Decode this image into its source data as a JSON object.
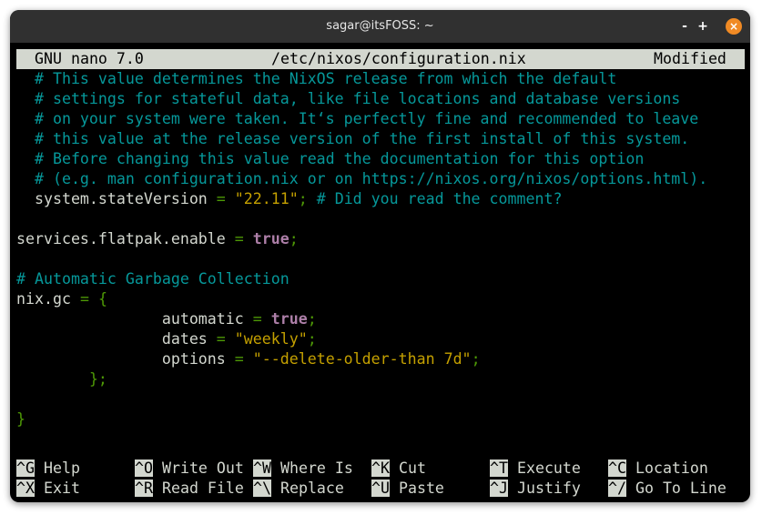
{
  "window": {
    "title": "sagar@itsFOSS: ~",
    "controls": {
      "minimize": "-",
      "maximize": "+",
      "close": "×"
    }
  },
  "nano": {
    "version": "GNU nano 7.0",
    "filename": "/etc/nixos/configuration.nix",
    "state": "Modified"
  },
  "lines": [
    [
      {
        "t": "  ",
        "c": "def"
      },
      {
        "t": "# This value determines the NixOS release from which the default",
        "c": "comment"
      }
    ],
    [
      {
        "t": "  ",
        "c": "def"
      },
      {
        "t": "# settings for stateful data, like file locations and database versions",
        "c": "comment"
      }
    ],
    [
      {
        "t": "  ",
        "c": "def"
      },
      {
        "t": "# on your system were taken. It‘s perfectly fine and recommended to leave",
        "c": "comment"
      }
    ],
    [
      {
        "t": "  ",
        "c": "def"
      },
      {
        "t": "# this value at the release version of the first install of this system.",
        "c": "comment"
      }
    ],
    [
      {
        "t": "  ",
        "c": "def"
      },
      {
        "t": "# Before changing this value read the documentation for this option",
        "c": "comment"
      }
    ],
    [
      {
        "t": "  ",
        "c": "def"
      },
      {
        "t": "# (e.g. man configuration.nix or on https://nixos.org/nixos/options.html).",
        "c": "comment"
      }
    ],
    [
      {
        "t": "  system.stateVersion ",
        "c": "def"
      },
      {
        "t": "=",
        "c": "op"
      },
      {
        "t": " ",
        "c": "def"
      },
      {
        "t": "\"22.11\"",
        "c": "str"
      },
      {
        "t": "; ",
        "c": "op"
      },
      {
        "t": "# Did you read the comment?",
        "c": "comment"
      }
    ],
    [],
    [
      {
        "t": "services.flatpak.enable ",
        "c": "def"
      },
      {
        "t": "=",
        "c": "op"
      },
      {
        "t": " ",
        "c": "def"
      },
      {
        "t": "true",
        "c": "kw"
      },
      {
        "t": ";",
        "c": "op"
      }
    ],
    [],
    [
      {
        "t": "# Automatic Garbage Collection",
        "c": "comment"
      }
    ],
    [
      {
        "t": "nix.gc ",
        "c": "def"
      },
      {
        "t": "=",
        "c": "op"
      },
      {
        "t": " ",
        "c": "def"
      },
      {
        "t": "{",
        "c": "op"
      }
    ],
    [
      {
        "t": "                automatic ",
        "c": "def"
      },
      {
        "t": "=",
        "c": "op"
      },
      {
        "t": " ",
        "c": "def"
      },
      {
        "t": "true",
        "c": "kw"
      },
      {
        "t": ";",
        "c": "op"
      }
    ],
    [
      {
        "t": "                dates ",
        "c": "def"
      },
      {
        "t": "=",
        "c": "op"
      },
      {
        "t": " ",
        "c": "def"
      },
      {
        "t": "\"weekly\"",
        "c": "str"
      },
      {
        "t": ";",
        "c": "op"
      }
    ],
    [
      {
        "t": "                options ",
        "c": "def"
      },
      {
        "t": "=",
        "c": "op"
      },
      {
        "t": " ",
        "c": "def"
      },
      {
        "t": "\"--delete-older-than 7d\"",
        "c": "str"
      },
      {
        "t": ";",
        "c": "op"
      }
    ],
    [
      {
        "t": "        ",
        "c": "def"
      },
      {
        "t": "};",
        "c": "op"
      }
    ],
    [],
    [
      {
        "t": "}",
        "c": "op"
      }
    ]
  ],
  "shortcuts": [
    [
      {
        "key": "^G",
        "label": "Help"
      },
      {
        "key": "^O",
        "label": "Write Out"
      },
      {
        "key": "^W",
        "label": "Where Is"
      },
      {
        "key": "^K",
        "label": "Cut"
      },
      {
        "key": "^T",
        "label": "Execute"
      },
      {
        "key": "^C",
        "label": "Location"
      }
    ],
    [
      {
        "key": "^X",
        "label": "Exit"
      },
      {
        "key": "^R",
        "label": "Read File"
      },
      {
        "key": "^\\",
        "label": "Replace"
      },
      {
        "key": "^U",
        "label": "Paste"
      },
      {
        "key": "^J",
        "label": "Justify"
      },
      {
        "key": "^/",
        "label": "Go To Line"
      }
    ]
  ]
}
